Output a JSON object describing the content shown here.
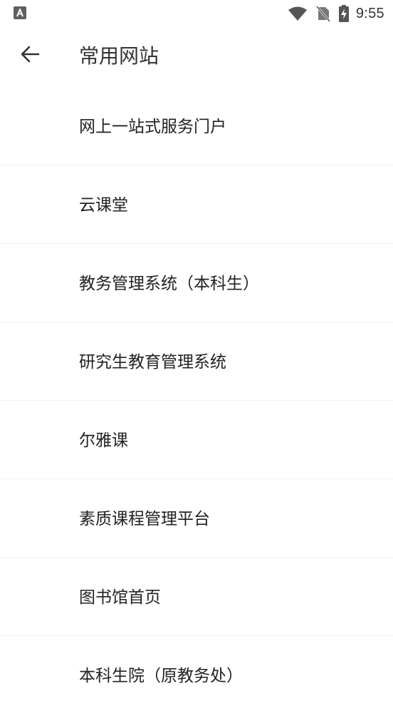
{
  "status_bar": {
    "time": "9:55",
    "icons": [
      "app-notification-icon",
      "wifi-icon",
      "no-sim-icon",
      "battery-charging-icon"
    ]
  },
  "app_bar": {
    "title": "常用网站",
    "back_icon": "arrow-left-icon"
  },
  "sites": [
    {
      "label": "网上一站式服务门户"
    },
    {
      "label": "云课堂"
    },
    {
      "label": "教务管理系统（本科生）"
    },
    {
      "label": "研究生教育管理系统"
    },
    {
      "label": "尔雅课"
    },
    {
      "label": "素质课程管理平台"
    },
    {
      "label": "图书馆首页"
    },
    {
      "label": "本科生院（原教务处）"
    }
  ]
}
